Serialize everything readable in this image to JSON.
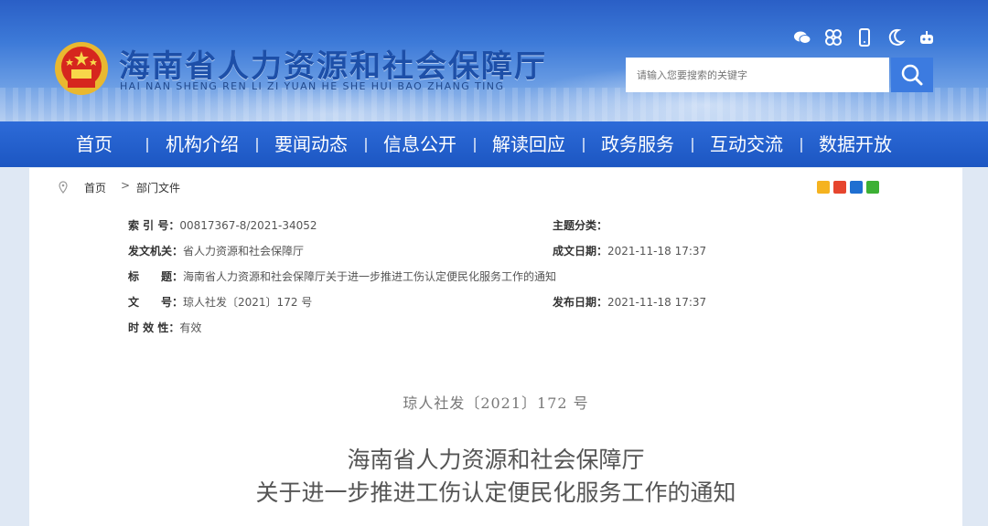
{
  "header": {
    "title": "海南省人力资源和社会保障厅",
    "pinyin": "HAI NAN SHENG REN LI ZI YUAN HE SHE HUI BAO ZHANG TING",
    "icons": [
      "wechat-icon",
      "app-grid-icon",
      "mobile-icon",
      "moon-icon",
      "robot-icon"
    ],
    "search": {
      "placeholder": "请输入您要搜索的关键字"
    }
  },
  "nav": {
    "items": [
      "首页",
      "机构介绍",
      "要闻动态",
      "信息公开",
      "解读回应",
      "政务服务",
      "互动交流",
      "数据开放"
    ]
  },
  "breadcrumb": {
    "home": "首页",
    "separator": ">",
    "current": "部门文件"
  },
  "share_icons": [
    "qzone-icon",
    "weibo-icon",
    "renren-icon",
    "wechat-share-icon"
  ],
  "meta": {
    "index_label": "索 引 号：",
    "index_value": "00817367-8/2021-34052",
    "topic_label": "主题分类：",
    "topic_value": "",
    "issuer_label": "发文机关：",
    "issuer_value": "省人力资源和社会保障厅",
    "date_label": "成文日期：",
    "date_value": "2021-11-18 17:37",
    "title_label": "标　　题：",
    "title_value": "海南省人力资源和社会保障厅关于进一步推进工伤认定便民化服务工作的通知",
    "docno_label": "文　　号：",
    "docno_value": "琼人社发〔2021〕172 号",
    "publish_label": "发布日期：",
    "publish_value": "2021-11-18 17:37",
    "validity_label": "时 效 性：",
    "validity_value": "有效"
  },
  "document": {
    "number": "琼人社发〔2021〕172 号",
    "title_line1": "海南省人力资源和社会保障厅",
    "title_line2": "关于进一步推进工伤认定便民化服务工作的通知"
  },
  "colors": {
    "nav": "#1c56c2",
    "title": "#1d4fa8",
    "search_button": "#3c7be0"
  }
}
